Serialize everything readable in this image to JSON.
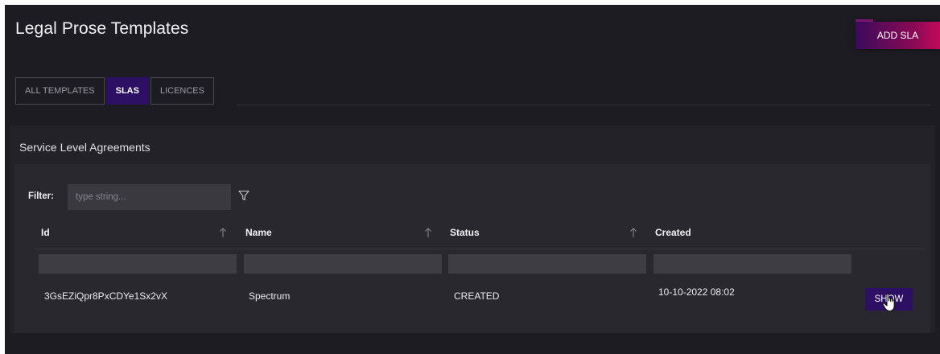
{
  "page": {
    "title": "Legal Prose Templates",
    "add_button_label": "ADD SLA"
  },
  "tabs": [
    {
      "label": "ALL TEMPLATES",
      "active": false
    },
    {
      "label": "SLAS",
      "active": true
    },
    {
      "label": "LICENCES",
      "active": false
    }
  ],
  "section": {
    "title": "Service Level Agreements"
  },
  "filter": {
    "label": "Filter:",
    "placeholder": "type string...",
    "value": ""
  },
  "table": {
    "columns": [
      "Id",
      "Name",
      "Status",
      "Created"
    ],
    "rows": [
      {
        "id": "3GsEZiQpr8PxCDYe1Sx2vX",
        "name": "Spectrum",
        "status": "CREATED",
        "created": "10-10-2022 08:02",
        "action_label": "SHOW"
      }
    ]
  },
  "colors": {
    "background": "#1e1c23",
    "active_tab": "#2d0f63",
    "accent_gradient_end": "#c2095a"
  },
  "icons": {
    "filter": "funnel-icon",
    "sort": "sort-arrow-up-icon",
    "cursor": "hand-pointer-icon"
  }
}
